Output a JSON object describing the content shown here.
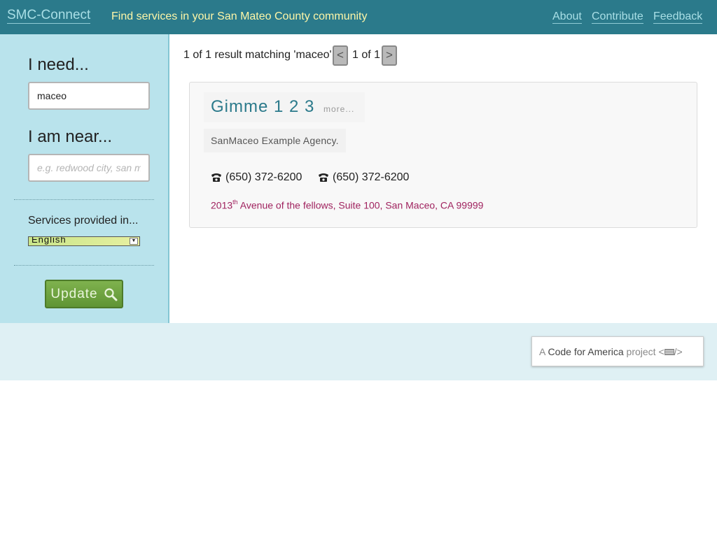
{
  "header": {
    "brand": "SMC-Connect",
    "tagline": "Find services in your San Mateo County community",
    "nav": {
      "about": "About",
      "contribute": "Contribute",
      "feedback": "Feedback"
    }
  },
  "sidebar": {
    "need_heading": "I need...",
    "need_value": "maceo",
    "near_heading": "I am near...",
    "near_placeholder": "e.g. redwood city, san mateo",
    "languages_label": "Services provided in...",
    "language_selected": "English",
    "update_label": "Update"
  },
  "results": {
    "summary": "1 of 1 result matching 'maceo'",
    "pager": {
      "prev": "<",
      "text": "1 of 1",
      "next": ">"
    },
    "items": [
      {
        "title": "Gimme 1 2 3",
        "more": "more...",
        "agency": "SanMaceo Example Agency.",
        "phones": [
          "(650) 372-6200",
          "(650) 372-6200"
        ],
        "address_number": "2013",
        "address_suffix": "th",
        "address_rest": " Avenue of the fellows, Suite 100, San Maceo, CA 99999"
      }
    ]
  },
  "footer": {
    "cfa_prefix": "A ",
    "cfa_org": "Code for America",
    "cfa_suffix": " project <",
    "cfa_end": "/>"
  },
  "colors": {
    "header_bg": "#2b7a8b",
    "sidebar_bg": "#b9e3ec",
    "tagline": "#fdf6a8",
    "link": "#2b7a8b",
    "address": "#a0235f",
    "button": "#6fa341"
  },
  "icons": {
    "phone": "telephone-icon",
    "search": "magnifier-icon",
    "flag": "us-flag-icon"
  }
}
